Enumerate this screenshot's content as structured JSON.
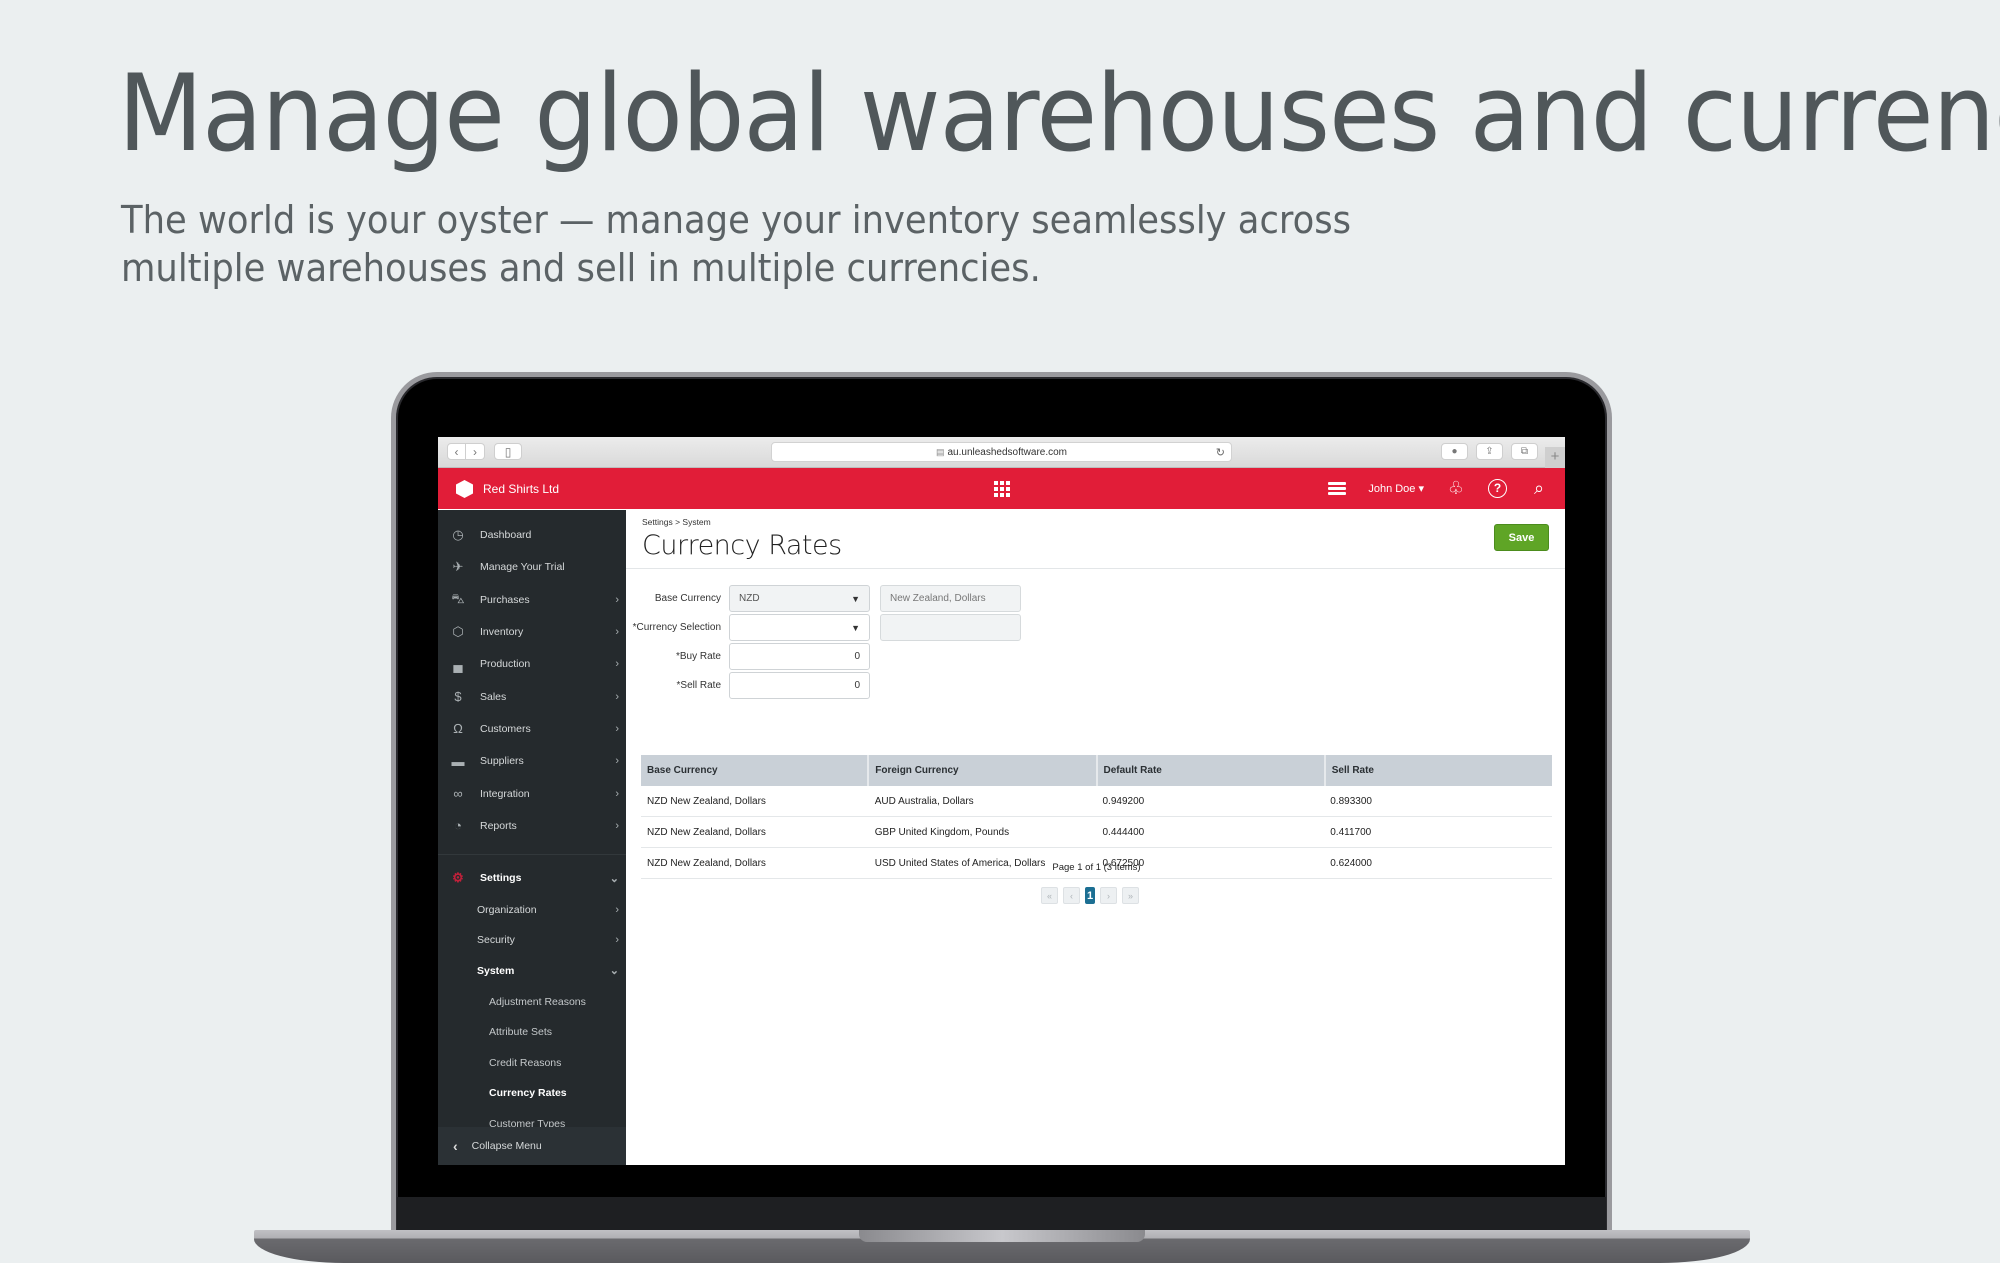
{
  "hero": {
    "title": "Manage global warehouses and currencies",
    "subtitle": "The world is your oyster — manage your inventory seamlessly across multiple warehouses and sell in multiple currencies."
  },
  "browser": {
    "url": "au.unleashedsoftware.com",
    "back_icon": "‹",
    "forward_icon": "›",
    "sidebar_icon": "▯",
    "lock_icon": "🔒",
    "reload_icon": "↻",
    "download_icon": "●",
    "share_icon": "⇪",
    "tabs_icon": "⧉",
    "new_tab_icon": "+"
  },
  "header": {
    "brand": "Red Shirts Ltd",
    "user": "John Doe ▾",
    "bell_icon": "🔔",
    "help_icon": "?",
    "search_icon": "⌕",
    "accent_color": "#e11d38"
  },
  "sidebar": {
    "items": [
      {
        "label": "Dashboard",
        "icon": "◷",
        "has_chevron": false
      },
      {
        "label": "Manage Your Trial",
        "icon": "✈",
        "has_chevron": false
      },
      {
        "label": "Purchases",
        "icon": "⛍",
        "has_chevron": true
      },
      {
        "label": "Inventory",
        "icon": "⬡",
        "has_chevron": true
      },
      {
        "label": "Production",
        "icon": "▄",
        "has_chevron": true
      },
      {
        "label": "Sales",
        "icon": "$",
        "has_chevron": true
      },
      {
        "label": "Customers",
        "icon": "Ω",
        "has_chevron": true
      },
      {
        "label": "Suppliers",
        "icon": "▬",
        "has_chevron": true
      },
      {
        "label": "Integration",
        "icon": "∞",
        "has_chevron": true
      },
      {
        "label": "Reports",
        "icon": "◔",
        "has_chevron": true
      }
    ],
    "settings": {
      "label": "Settings",
      "icon": "⚙"
    },
    "settings_children": [
      {
        "label": "Organization",
        "chevron": "›"
      },
      {
        "label": "Security",
        "chevron": "›"
      },
      {
        "label": "System",
        "chevron": "⌄"
      }
    ],
    "system_children": [
      {
        "label": "Adjustment Reasons"
      },
      {
        "label": "Attribute Sets"
      },
      {
        "label": "Credit Reasons"
      },
      {
        "label": "Currency Rates",
        "active": true
      },
      {
        "label": "Customer Types"
      }
    ],
    "collapse_label": "Collapse Menu",
    "collapse_icon": "‹",
    "chevron": "›",
    "chevron_down": "⌄"
  },
  "main": {
    "breadcrumb": "Settings > System",
    "title": "Currency Rates",
    "save_label": "Save",
    "form": {
      "base_currency_label": "Base Currency",
      "base_currency_value": "NZD",
      "base_currency_desc": "New Zealand, Dollars",
      "currency_selection_label": "*Currency Selection",
      "currency_selection_value": "",
      "currency_selection_desc": "",
      "buy_rate_label": "*Buy Rate",
      "buy_rate_value": "0",
      "sell_rate_label": "*Sell Rate",
      "sell_rate_value": "0",
      "caret": "▼"
    },
    "table": {
      "columns": [
        "Base Currency",
        "Foreign Currency",
        "Default Rate",
        "Sell Rate"
      ],
      "rows": [
        [
          "NZD New Zealand, Dollars",
          "AUD Australia, Dollars",
          "0.949200",
          "0.893300"
        ],
        [
          "NZD New Zealand, Dollars",
          "GBP United Kingdom, Pounds",
          "0.444400",
          "0.411700"
        ],
        [
          "NZD New Zealand, Dollars",
          "USD United States of America, Dollars",
          "0.672500",
          "0.624000"
        ]
      ]
    },
    "pager": {
      "summary": "Page 1 of 1 (3 items)",
      "first": "«",
      "prev": "‹",
      "current": "1",
      "next": "›",
      "last": "»"
    }
  }
}
